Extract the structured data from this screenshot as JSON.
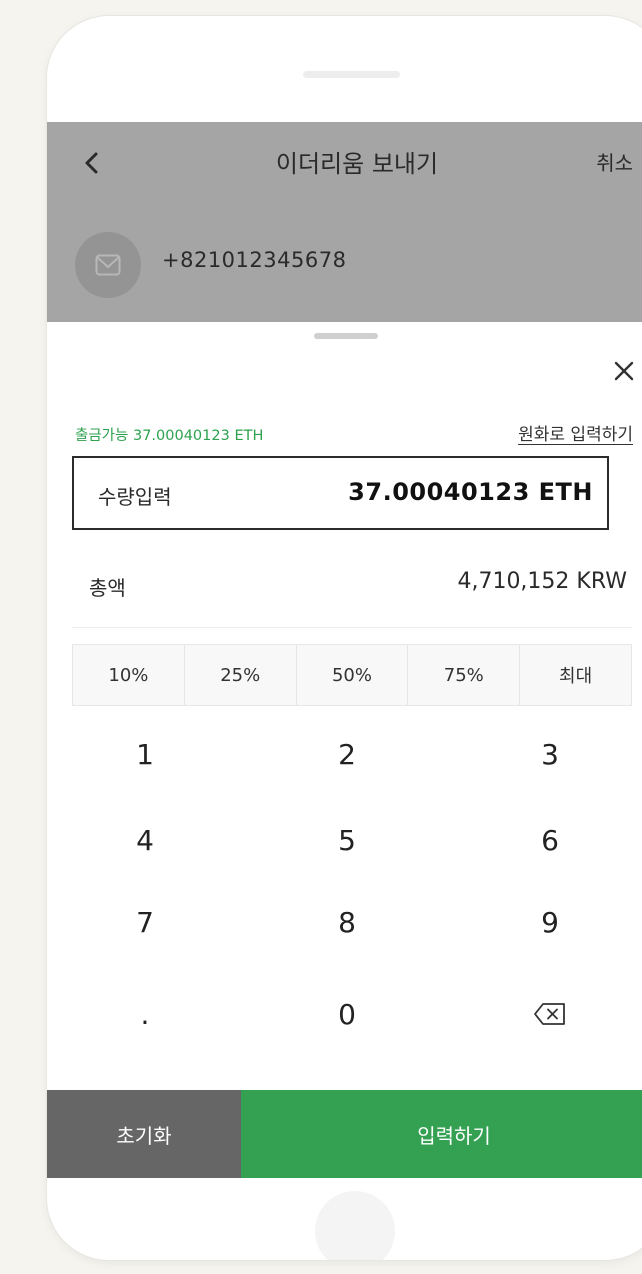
{
  "header": {
    "title": "이더리움 보내기",
    "cancel_label": "취소",
    "back_icon": "chevron-left-icon"
  },
  "recipient": {
    "icon": "mail-icon",
    "phone": "+821012345678"
  },
  "sheet": {
    "available_text": "출금가능 37.00040123 ETH",
    "krw_input_link": "원화로 입력하기",
    "amount_label": "수량입력",
    "amount_value": "37.00040123 ETH",
    "total_label": "총액",
    "total_value": "4,710,152 KRW",
    "percent_options": [
      "10%",
      "25%",
      "50%",
      "75%",
      "최대"
    ]
  },
  "keypad": {
    "keys": [
      "1",
      "2",
      "3",
      "4",
      "5",
      "6",
      "7",
      "8",
      "9",
      ".",
      "0"
    ],
    "backspace_icon": "backspace-icon"
  },
  "footer": {
    "reset_label": "초기화",
    "submit_label": "입력하기"
  },
  "colors": {
    "accent_green": "#34a052",
    "available_green": "#2ea24f",
    "overlay_gray": "#a5a5a5",
    "reset_gray": "#666666"
  }
}
